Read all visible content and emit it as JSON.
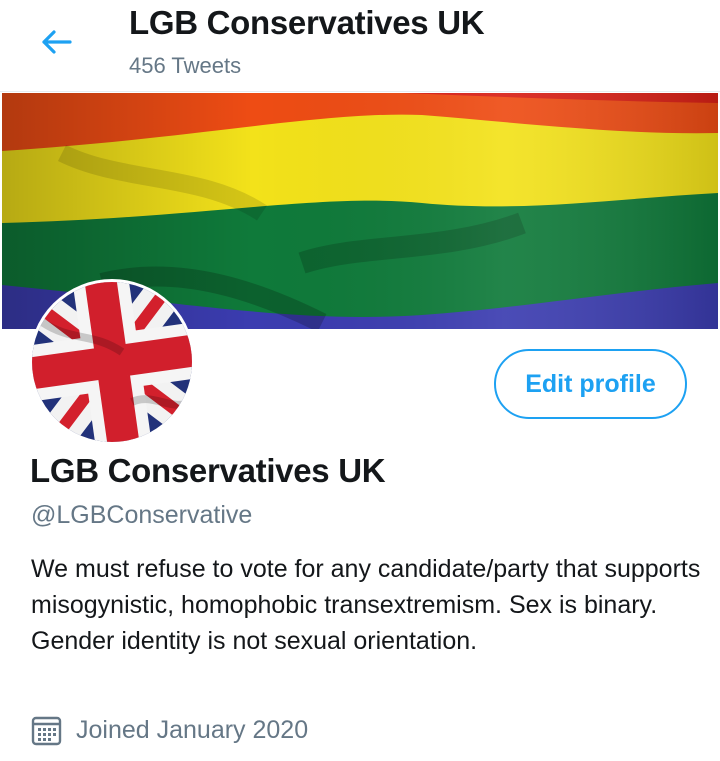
{
  "header": {
    "title": "LGB Conservatives UK",
    "tweet_count": "456 Tweets",
    "back_icon": "arrow-left-icon"
  },
  "profile": {
    "name": "LGB Conservatives UK",
    "handle": "@LGBConservative",
    "bio": "We must refuse to vote for any candidate/party that supports misogynistic, homophobic transextremism. Sex is binary. Gender identity is not sexual orientation.",
    "joined": "Joined January 2020",
    "joined_icon": "calendar-icon",
    "edit_button_label": "Edit profile",
    "banner_image": "rainbow-flag",
    "avatar_image": "union-jack-flag"
  },
  "colors": {
    "accent": "#1da1f2",
    "secondary_text": "#657786",
    "primary_text": "#14171a"
  }
}
